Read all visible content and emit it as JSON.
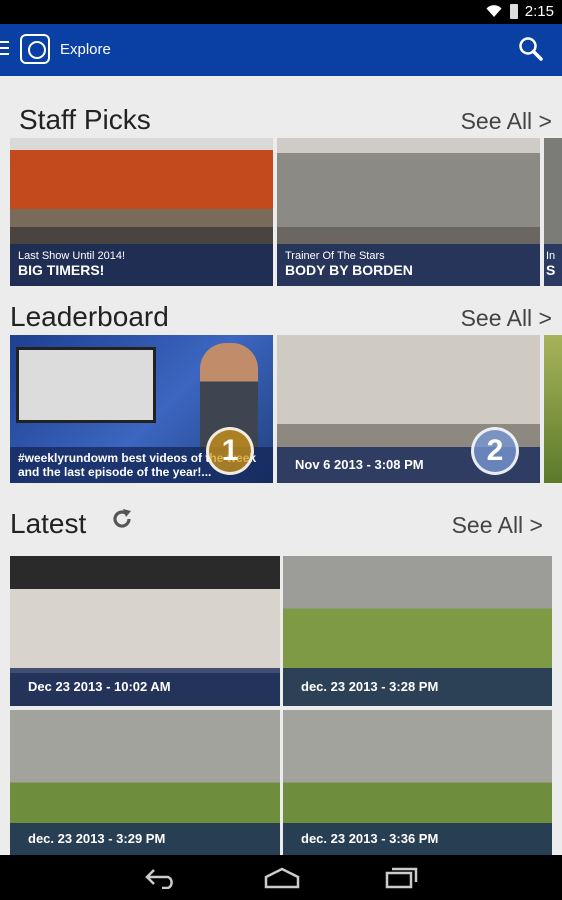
{
  "status": {
    "time": "2:15"
  },
  "header": {
    "title": "Explore"
  },
  "staff_picks": {
    "title": "Staff Picks",
    "see_all": "See All >",
    "items": [
      {
        "sub": "Last Show Until 2014!",
        "main": "BIG TIMERS!"
      },
      {
        "sub": "Trainer Of The Stars",
        "main": "BODY BY BORDEN"
      },
      {
        "sub": "In",
        "main": "S"
      }
    ]
  },
  "leaderboard": {
    "title": "Leaderboard",
    "see_all": "See All >",
    "items": [
      {
        "rank": "1",
        "caption": "#weeklyrundowm best videos of the week and the last episode of the year!..."
      },
      {
        "rank": "2",
        "caption": "Nov 6 2013 - 3:08 PM"
      }
    ]
  },
  "latest": {
    "title": "Latest",
    "see_all": "See All >",
    "items": [
      {
        "caption": "Dec 23 2013 - 10:02 AM"
      },
      {
        "caption": "dec. 23 2013 - 3:28 PM"
      },
      {
        "caption": "dec. 23 2013 - 3:29 PM"
      },
      {
        "caption": "dec. 23 2013 - 3:36 PM"
      }
    ]
  }
}
